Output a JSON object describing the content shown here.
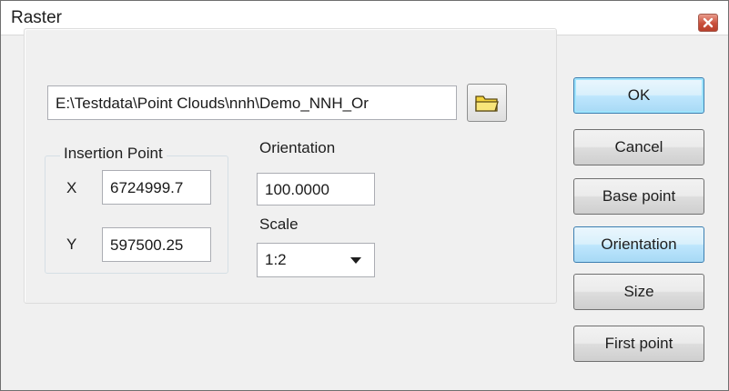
{
  "window": {
    "title": "Raster",
    "close_icon": "close-icon"
  },
  "file": {
    "path": "E:\\Testdata\\Point Clouds\\nnh\\Demo_NNH_Or",
    "browse_icon": "folder-icon"
  },
  "insertion_point": {
    "legend": "Insertion Point",
    "x_label": "X",
    "x_value": "6724999.7",
    "y_label": "Y",
    "y_value": "597500.25"
  },
  "orientation": {
    "label": "Orientation",
    "value": "100.0000"
  },
  "scale": {
    "label": "Scale",
    "selected": "1:2"
  },
  "buttons": {
    "ok": "OK",
    "cancel": "Cancel",
    "base_point": "Base point",
    "orientation": "Orientation",
    "size": "Size",
    "first_point": "First point"
  },
  "colors": {
    "close_button": "#c9503c",
    "default_button_border": "#3c7fb1",
    "folder": "#f2d23c"
  }
}
